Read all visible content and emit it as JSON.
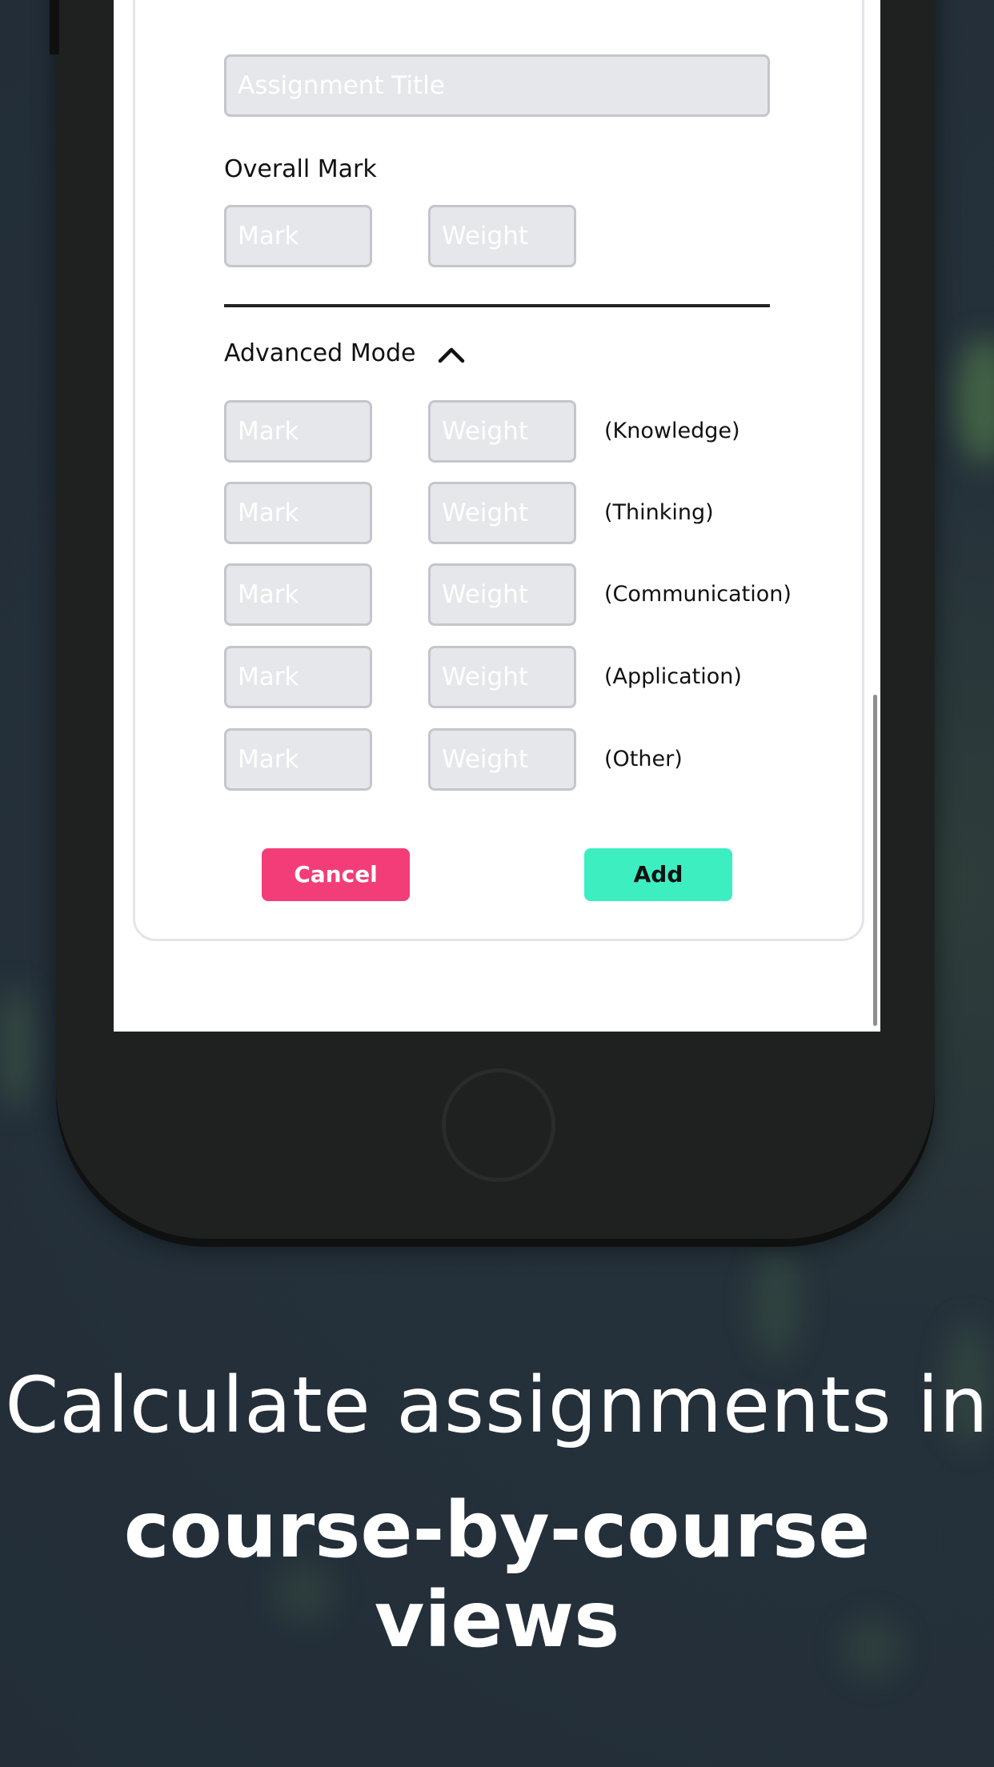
{
  "form": {
    "title_placeholder": "Assignment Title",
    "overall_label": "Overall Mark",
    "mark_placeholder": "Mark",
    "weight_placeholder": "Weight",
    "advanced_label": "Advanced Mode",
    "categories": [
      "(Knowledge)",
      "(Thinking)",
      "(Communication)",
      "(Application)",
      "(Other)"
    ],
    "cancel_label": "Cancel",
    "add_label": "Add"
  },
  "caption": {
    "line1": "Calculate assignments in",
    "line2": "course-by-course views"
  },
  "colors": {
    "cancel": "#f23d78",
    "add": "#3deec0",
    "background": "#222d38"
  },
  "icons": {
    "advanced_toggle": "chevron-up-icon"
  }
}
